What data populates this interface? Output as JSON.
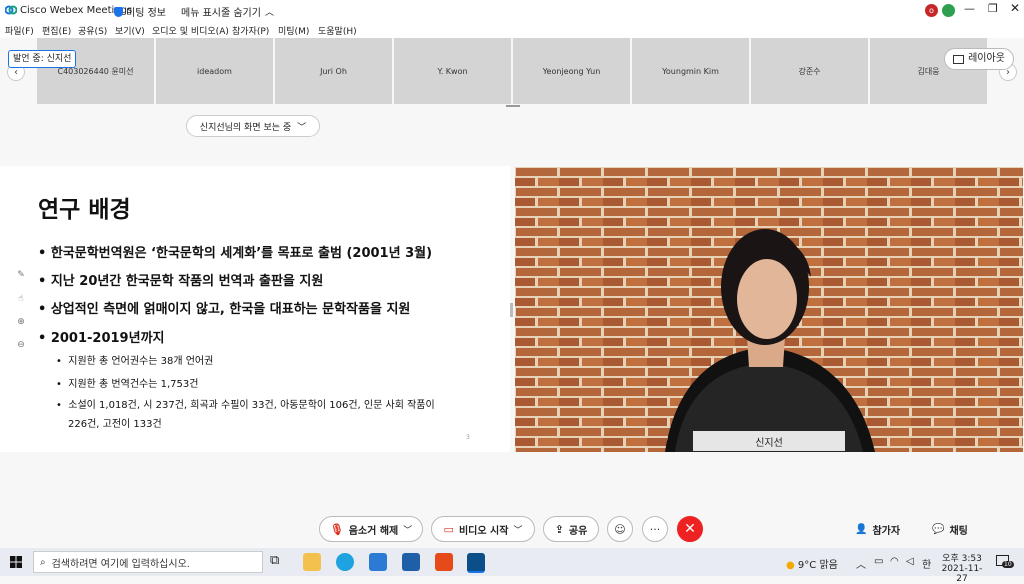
{
  "window": {
    "app_title": "Cisco Webex Meetings",
    "meeting_info": "미팅 정보",
    "hide_menu": "메뉴 표시줄 숨기기",
    "avatar_letter": "o"
  },
  "menu": [
    "파일(F)",
    "편집(E)",
    "공유(S)",
    "보기(V)",
    "오디오 및 비디오(A)",
    "참가자(P)",
    "미팅(M)",
    "도움말(H)"
  ],
  "participants": [
    "C403026440 윤미선",
    "ideadom",
    "Juri Oh",
    "Y. Kwon",
    "Yeonjeong Yun",
    "Youngmin Kim",
    "강준수",
    "김대웅"
  ],
  "speaker_badge": "발언 중: 신지선",
  "layout_label": "레이아웃",
  "viewing_label": "신지선님의 화면 보는 중",
  "slide": {
    "title": "연구 배경",
    "bullets": [
      "한국문학번역원은 ‘한국문학의 세계화’를 목표로 출범 (2001년 3월)",
      "지난 20년간 한국문학 작품의 번역과 출판을 지원",
      "상업적인 측면에 얽매이지 않고, 한국을 대표하는 문학작품을 지원",
      "2001-2019년까지"
    ],
    "sub_bullets": [
      "지원한 총 언어권수는 38개 언어권",
      "지원한 총 번역건수는 1,753건",
      "소설이 1,018건, 시 237건, 희곡과 수필이 33건, 아동문학이 106건, 인문 사회 작품이"
    ],
    "sub_bullet_cont": "226건, 고전이 133건",
    "page_number": "3"
  },
  "video_name": "신지선",
  "controls": {
    "unmute": "음소거 해제",
    "start_video": "비디오 시작",
    "share": "공유",
    "more": "···",
    "participants": "참가자",
    "chat": "채팅"
  },
  "taskbar": {
    "search_placeholder": "검색하려면 여기에 입력하십시오.",
    "weather": "9°C 맑음",
    "ime": "한",
    "time": "오후 3:53",
    "date": "2021-11-27",
    "notif_count": "10"
  },
  "colors": {
    "accent": "#1a73e8",
    "end_red": "#e22222",
    "brick": "#b5673c"
  }
}
